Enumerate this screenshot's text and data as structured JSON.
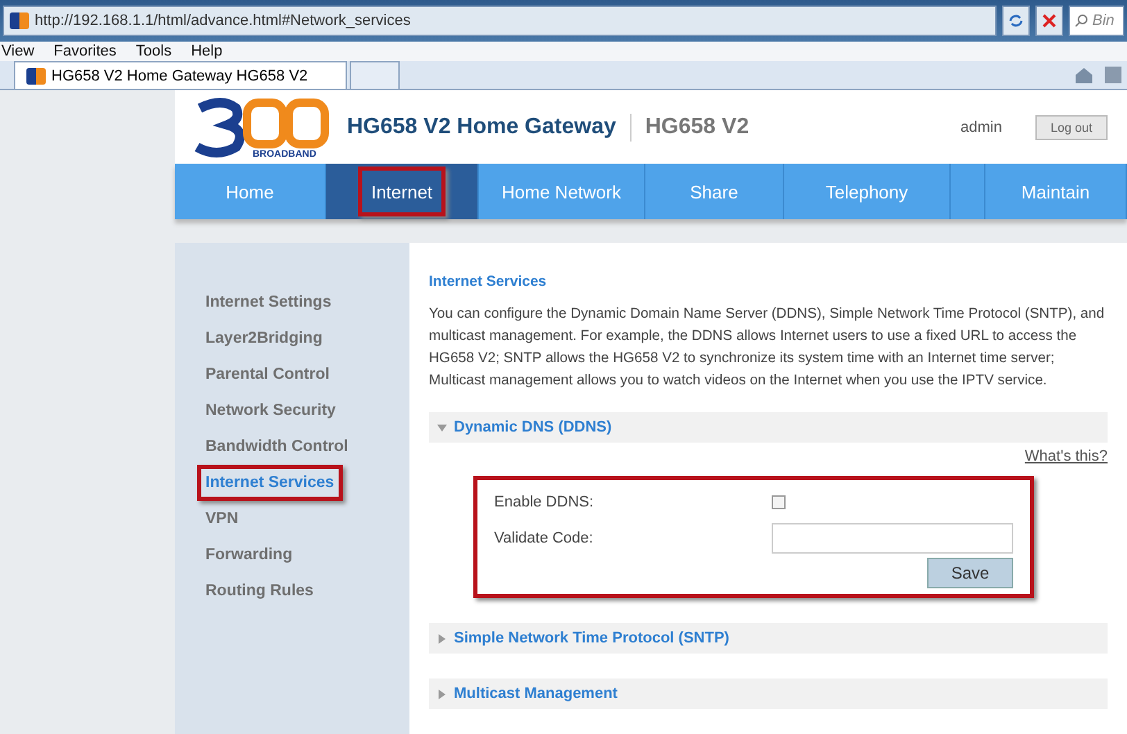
{
  "browser": {
    "address": "http://192.168.1.1/html/advance.html#Network_services",
    "search_placeholder": "Bin",
    "menu": [
      "View",
      "Favorites",
      "Tools",
      "Help"
    ],
    "tabs": [
      {
        "label": "HG658 V2 Home Gateway HG658 V2",
        "selected": true
      },
      {
        "selected": false
      }
    ]
  },
  "header": {
    "logo_text": "BROADBAND",
    "title": "HG658 V2 Home Gateway",
    "model": "HG658 V2",
    "user": "admin",
    "logout": "Log out"
  },
  "nav": [
    {
      "label": "Home",
      "selected": false,
      "highlighted": false
    },
    {
      "label": "Internet",
      "selected": true,
      "highlighted": true
    },
    {
      "label": "Home Network",
      "selected": false,
      "highlighted": false
    },
    {
      "label": "Share",
      "selected": false,
      "highlighted": false
    },
    {
      "label": "Telephony",
      "selected": false,
      "highlighted": false
    },
    {
      "selected": false,
      "highlighted": false
    },
    {
      "label": "Maintain",
      "selected": false,
      "highlighted": false
    }
  ],
  "sidebar": [
    {
      "label": "Internet Settings",
      "selected": false,
      "highlighted": false
    },
    {
      "label": "Layer2Bridging",
      "selected": false,
      "highlighted": false
    },
    {
      "label": "Parental Control",
      "selected": false,
      "highlighted": false
    },
    {
      "label": "Network Security",
      "selected": false,
      "highlighted": false
    },
    {
      "label": "Bandwidth Control",
      "selected": false,
      "highlighted": false
    },
    {
      "label": "Internet Services",
      "selected": true,
      "highlighted": true
    },
    {
      "label": "VPN",
      "selected": false,
      "highlighted": false
    },
    {
      "label": "Forwarding",
      "selected": false,
      "highlighted": false
    },
    {
      "label": "Routing Rules",
      "selected": false,
      "highlighted": false
    }
  ],
  "content": {
    "title": "Internet Services",
    "description": "You can configure the Dynamic Domain Name Server (DDNS), Simple Network Time Protocol (SNTP), and multicast management. For example, the DDNS allows Internet users to use a fixed URL to access the HG658 V2; SNTP allows the HG658 V2 to synchronize its system time with an Internet time server; Multicast management allows you to watch videos on the Internet when you use the IPTV service.",
    "sections": [
      {
        "title": "Dynamic DNS (DDNS)",
        "expanded": true,
        "help": "What's this?",
        "highlighted": true,
        "fields": [
          {
            "kind": "checkbox",
            "label": "Enable DDNS:",
            "checked": false
          },
          {
            "kind": "text",
            "label": "Validate Code:"
          }
        ],
        "button": "Save"
      },
      {
        "title": "Simple Network Time Protocol (SNTP)",
        "expanded": false
      },
      {
        "title": "Multicast Management",
        "expanded": false
      }
    ]
  }
}
